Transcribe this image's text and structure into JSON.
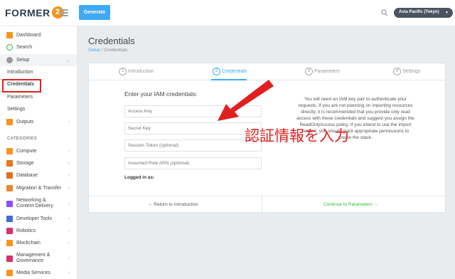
{
  "header": {
    "logo_text": "FORMER",
    "logo_badge": "2",
    "generate_label": "Generate",
    "region_label": "Asia Pacific (Tokyo)"
  },
  "sidebar": {
    "dashboard": "Dashboard",
    "search": "Search",
    "setup": "Setup",
    "setup_items": [
      "Introduction",
      "Credentials",
      "Parameters",
      "Settings"
    ],
    "outputs": "Outputs",
    "categories_title": "CATEGORIES",
    "categories": [
      "Compute",
      "Storage",
      "Database",
      "Migration & Transfer",
      "Networking &",
      "Content Delivery",
      "Developer Tools",
      "Robotics",
      "Blockchain",
      "Management &",
      "Governance",
      "Media Services"
    ]
  },
  "main": {
    "title": "Credentials",
    "breadcrumb_root": "Setup",
    "breadcrumb_sep": "/",
    "breadcrumb_current": "Credentials"
  },
  "steps": [
    {
      "num": "1",
      "label": "Introduction"
    },
    {
      "num": "2",
      "label": "Credentials"
    },
    {
      "num": "3",
      "label": "Parameters"
    },
    {
      "num": "4",
      "label": "Settings"
    }
  ],
  "form": {
    "title": "Enter your IAM credentials:",
    "access_key_placeholder": "Access Key",
    "secret_key_placeholder": "Secret Key",
    "session_token_placeholder": "Session Token (optional)",
    "assumed_role_placeholder": "Assumed Role ARN (optional)",
    "logged_in_label": "Logged in as:"
  },
  "help_text": "You will need an IAM key pair to authenticate your requests. If you are not planning on importing resources directly, it is recommended that you provide only read access with these credentials and suggest you assign the ReadOnlyAccess policy. If you intend to use the import feature, you should grant appropriate permissions to create the stack.",
  "footer": {
    "back_label": "← Return to Introduction",
    "continue_label": "Continue to Parameters →"
  },
  "annotation": {
    "text": "認証情報を入力",
    "color": "#e02020"
  },
  "colors": {
    "accent": "#3fa9f5",
    "success": "#2eb82e",
    "brand_orange": "#f7941d"
  }
}
